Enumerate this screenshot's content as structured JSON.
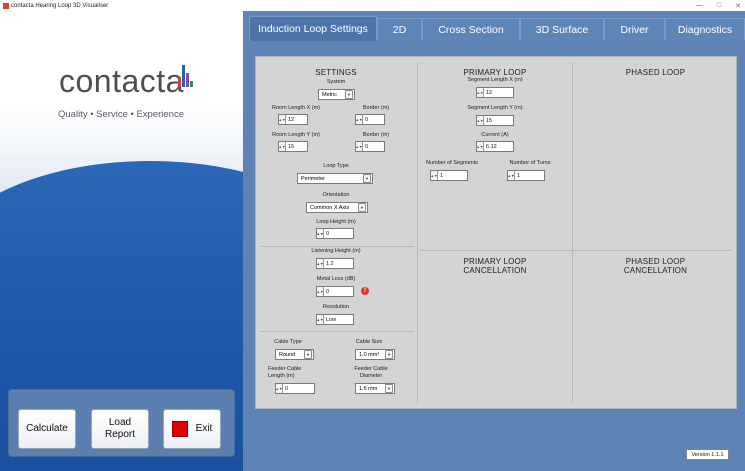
{
  "window": {
    "title": "contacta Hearing Loop 3D Visualiser",
    "minimize": "—",
    "maximize": "□",
    "close": "✕"
  },
  "brand": {
    "name": "contacta",
    "tagline": "Quality • Service • Experience",
    "bar_colors": [
      "#e03a3a",
      "#2d5fb0",
      "#7a4fb0",
      "#3a8a4f"
    ]
  },
  "buttons": {
    "calculate": "Calculate",
    "load_report": "Load\nReport",
    "exit": "Exit"
  },
  "tabs": [
    "Induction Loop Settings",
    "2D",
    "Cross Section",
    "3D Surface",
    "Driver",
    "Diagnostics"
  ],
  "settings": {
    "title": "SETTINGS",
    "system_label": "System",
    "system_value": "Metric",
    "room_x_label": "Room Length X (m)",
    "room_x_value": "12",
    "border1_label": "Border (m)",
    "border1_value": "0",
    "room_y_label": "Room Length Y (m)",
    "room_y_value": "15",
    "border2_label": "Border (m)",
    "border2_value": "0",
    "loop_type_label": "Loop Type",
    "loop_type_value": "Perimeter",
    "orientation_label": "Orientation",
    "orientation_value": "Common X Axis",
    "loop_height_label": "Loop Height (m)",
    "loop_height_value": "0",
    "listening_height_label": "Listening Height (m)",
    "listening_height_value": "1.2",
    "metal_loss_label": "Metal Loss (dB)",
    "metal_loss_value": "0",
    "resolution_label": "Resolution",
    "resolution_value": "Low",
    "cable_type_label": "Cable Type",
    "cable_type_value": "Round",
    "cable_size_label": "Cable Size",
    "cable_size_value": "1.0 mm²",
    "feeder_length_label": "Feeder Cable\nLength (m)",
    "feeder_length_value": "0",
    "feeder_diameter_label": "Feeder Cable\nDiameter",
    "feeder_diameter_value": "1.5 mm"
  },
  "primary_loop": {
    "title": "PRIMARY LOOP",
    "seg_x_label": "Segment Length X (m)",
    "seg_x_value": "12",
    "seg_y_label": "Segment Length Y (m)",
    "seg_y_value": "15",
    "current_label": "Current (A)",
    "current_value": "6.12",
    "num_segments_label": "Number of Segments",
    "num_segments_value": "1",
    "num_turns_label": "Number of Turns",
    "num_turns_value": "1"
  },
  "phased_loop": {
    "title": "PHASED LOOP"
  },
  "primary_cancel": {
    "title": "PRIMARY LOOP\nCANCELLATION"
  },
  "phased_cancel": {
    "title": "PHASED LOOP\nCANCELLATION"
  },
  "version": "Version 1.1.1"
}
